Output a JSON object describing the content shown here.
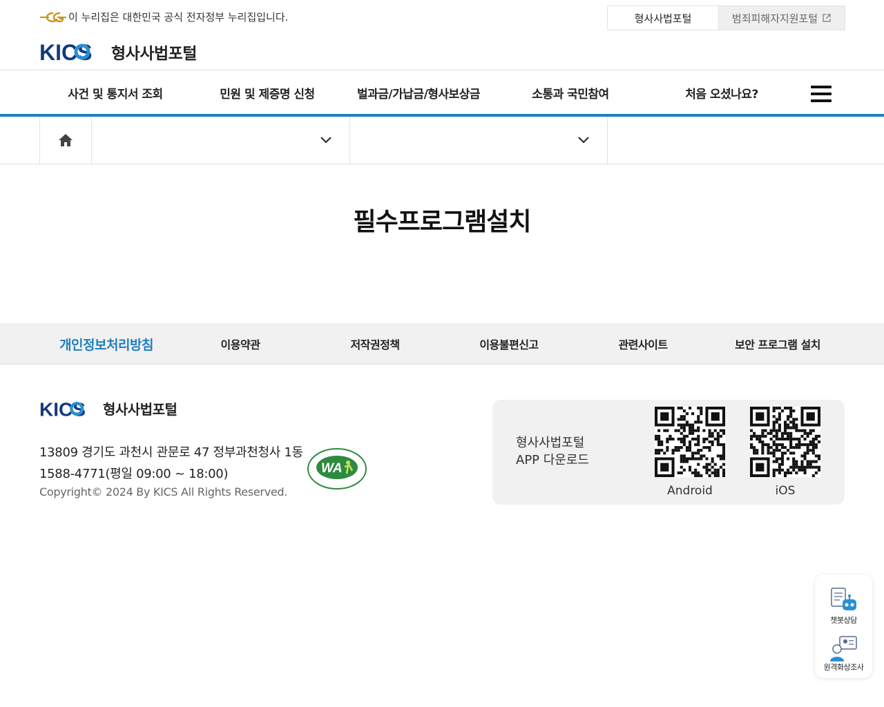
{
  "top": {
    "gov_notice": "이 누리집은 대한민국 공식 전자정부 누리집입니다.",
    "portal_active": "형사사법포털",
    "portal_other": "범죄피해자지원포털"
  },
  "site": {
    "logo_text": "KICS",
    "name": "형사사법포털"
  },
  "gnb": {
    "items": [
      "사건 및 통지서 조회",
      "민원 및 제증명 신청",
      "벌과금/가납금/형사보상금",
      "소통과 국민참여",
      "처음 오셨나요?"
    ]
  },
  "page": {
    "title": "필수프로그램설치"
  },
  "footer_menu": {
    "items": [
      "개인정보처리방침",
      "이용약관",
      "저작권정책",
      "이용불편신고",
      "관련사이트",
      "보안 프로그램 설치"
    ]
  },
  "footer": {
    "logo_text": "KICS",
    "name": "형사사법포털",
    "address": "13809 경기도 과천시 관문로 47 정부과천청사 1동",
    "phone": "1588-4771(평일 09:00 ~ 18:00)",
    "copyright": "Copyright© 2024 By KICS All Rights Reserved.",
    "wa_mark_text": "WA",
    "app": {
      "label_line1": "형사사법포털",
      "label_line2": "APP 다운로드",
      "android": "Android",
      "ios": "iOS"
    }
  },
  "floating": {
    "chatbot": "챗봇상담",
    "video": "원격화상조사"
  },
  "colors": {
    "accent": "#1f7fc0",
    "brand_navy": "#123a7a",
    "brand_blue": "#2a8fd4",
    "footer_bg": "#f1f1f1"
  }
}
